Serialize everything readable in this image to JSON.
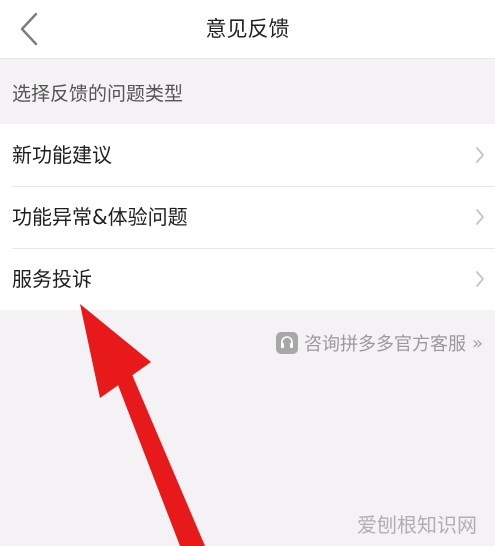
{
  "header": {
    "title": "意见反馈",
    "back_icon": "chevron-left-icon"
  },
  "section": {
    "label": "选择反馈的问题类型"
  },
  "list": {
    "items": [
      {
        "label": "新功能建议",
        "icon": "chevron-right-icon"
      },
      {
        "label": "功能异常&体验问题",
        "icon": "chevron-right-icon"
      },
      {
        "label": "服务投诉",
        "icon": "chevron-right-icon"
      }
    ]
  },
  "service": {
    "label": "咨询拼多多官方客服",
    "arrow": "»",
    "icon": "headset-icon"
  },
  "annotation": {
    "color": "#e8191a",
    "icon": "red-arrow-annotation"
  },
  "watermark": {
    "text": "爱刨根知识网"
  }
}
